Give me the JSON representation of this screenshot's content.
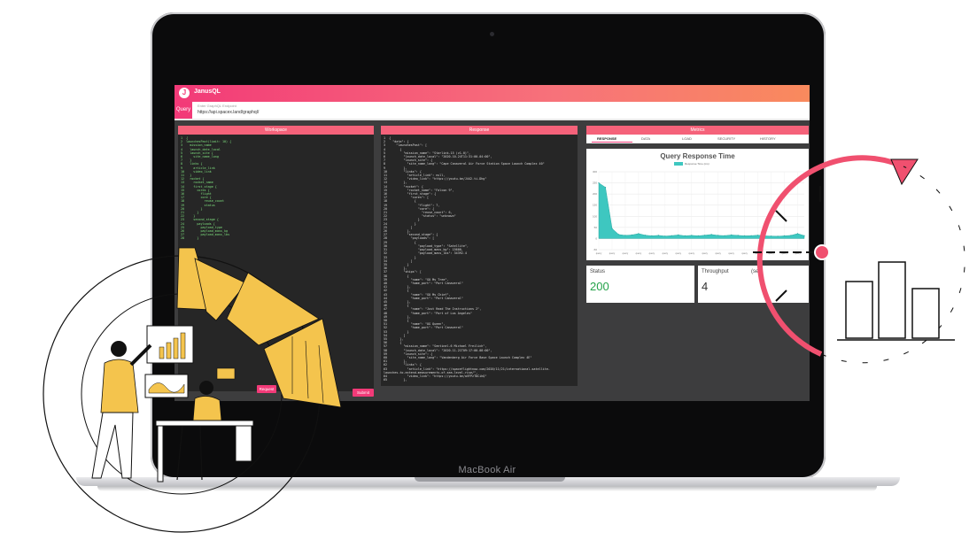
{
  "device_label": "MacBook Air",
  "app": {
    "title": "JanusQL",
    "logo_letter": "J",
    "query_label": "Query",
    "query_hint": "Enter GraphQL Endpoint",
    "query_url": "https://api.spacex.land/graphql/"
  },
  "workspace": {
    "header": "Workspace",
    "code": "1  {\n2  launchesPast(limit: 10) {\n3    mission_name\n4    launch_date_local\n5    launch_site {\n6      site_name_long\n7    }\n8    links {\n9      article_link\n10     video_link\n11   }\n12   rocket {\n13     rocket_name\n14     first_stage {\n15       cores {\n16         flight\n17         core {\n18           reuse_count\n19           status\n20         }\n21       }\n22     }\n23     second_stage {\n24       payloads {\n25         payload_type\n26         payload_mass_kg\n27         payload_mass_lbs\n28       }",
    "send_button": "Request"
  },
  "response": {
    "header": "Response",
    "code": "1  {\n2    \"data\": {\n3      \"launchesPast\": [\n4        {\n5          \"mission_name\": \"Starlink-15 (v1.0)\",\n6          \"launch_date_local\": \"2020-10-24T11:31:00-04:00\",\n7          \"launch_site\": {\n8            \"site_name_long\": \"Cape Canaveral Air Force Station Space Launch Complex 40\"\n9          },\n10         \"links\": {\n11           \"article_link\": null,\n12           \"video_link\": \"https://youtu.be/J442-ti-Dhg\"\n13         },\n14         \"rocket\": {\n15           \"rocket_name\": \"Falcon 9\",\n16           \"first_stage\": {\n17             \"cores\": [\n18               {\n19                 \"flight\": 7,\n20                 \"core\": {\n21                   \"reuse_count\": 6,\n22                   \"status\": \"unknown\"\n23                 }\n24               }\n25             ]\n26           },\n27           \"second_stage\": {\n28             \"payloads\": [\n29               {\n30                 \"payload_type\": \"Satellite\",\n31                 \"payload_mass_kg\": 15600,\n32                 \"payload_mass_lbs\": 34392.4\n33               }\n34             ]\n35           }\n36         },\n37         \"ships\": [\n38           {\n39             \"name\": \"GO Ms Tree\",\n40             \"home_port\": \"Port Canaveral\"\n41           },\n42           {\n43             \"name\": \"GO Ms Chief\",\n44             \"home_port\": \"Port Canaveral\"\n45           },\n46           {\n47             \"name\": \"Just Read The Instructions 2\",\n48             \"home_port\": \"Port of Los Angeles\"\n49           },\n50           {\n51             \"name\": \"OG Queen\",\n52             \"home_port\": \"Port Canaveral\"\n53           }\n54         ]\n55       },\n56       {\n57         \"mission_name\": \"Sentinel-6 Michael Freilich\",\n58         \"launch_date_local\": \"2020-11-21T09:17:00-08:00\",\n59         \"launch_site\": {\n60           \"site_name_long\": \"Vandenberg Air Force Base Space Launch Complex 4E\"\n61         },\n62         \"links\": {\n63           \"article_link\": \"https://spaceflightnow.com/2020/11/21/international-satellite-\nlaunches-to-extend-measurements-of-sea-level-rise/\",\n64           \"video_link\": \"https://youtu.be/aVFPzTDCihQ\"\n65         },",
    "submit_button": "Submit"
  },
  "metrics": {
    "header": "Metrics",
    "tabs": [
      "RESPONSE",
      "DATA",
      "LOAD",
      "SECURITY",
      "HISTORY"
    ],
    "status_label": "Status",
    "status_value": "200",
    "throughput_label": "Throughput",
    "throughput_suffix": "(sec)",
    "throughput_value": "4"
  },
  "chart_data": {
    "type": "area",
    "title": "Query Response Time",
    "series": [
      {
        "name": "Response Time (ms)",
        "color": "#3ec7c0",
        "values": [
          250,
          230,
          45,
          18,
          14,
          16,
          22,
          15,
          12,
          14,
          11,
          13,
          16,
          12,
          14,
          12,
          15,
          18,
          14,
          13,
          16,
          14,
          12,
          13,
          15,
          12,
          11,
          10,
          12,
          14,
          22,
          13
        ]
      }
    ],
    "y_ticks": [
      "300",
      "250",
      "200",
      "150",
      "100",
      "50",
      "0",
      "-50"
    ],
    "ylim": [
      -50,
      300
    ],
    "x_tick_label": "query",
    "grid": true,
    "legend": "top-center"
  },
  "colors": {
    "brand_pink": "#f23a78",
    "brand_orange": "#f98a5d",
    "status_green": "#25a24a",
    "chart_teal": "#3ec7c0",
    "illustration_yellow": "#f4c44d"
  }
}
